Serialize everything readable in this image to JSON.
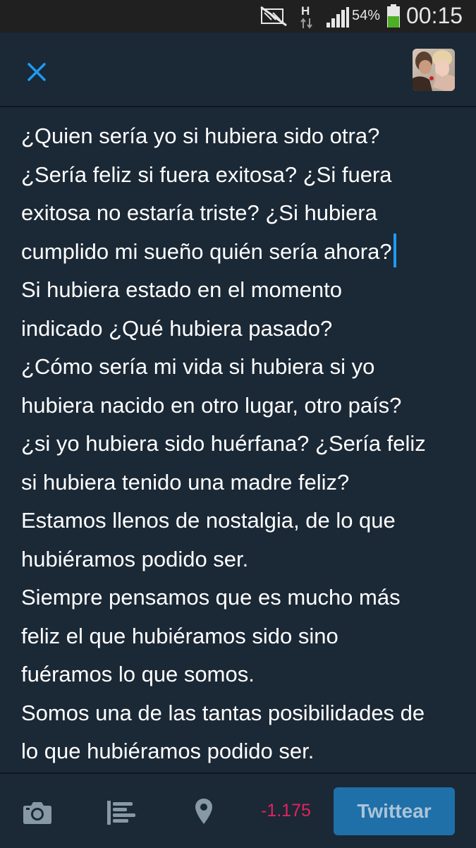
{
  "status_bar": {
    "network_label": "H",
    "battery_percent": "54%",
    "battery_level": 0.54,
    "time": "00:15",
    "icons": [
      "mute-icon",
      "data-transfer-icon",
      "signal-icon",
      "battery-icon"
    ]
  },
  "header": {
    "close_icon": "close-icon",
    "avatar": "user-avatar"
  },
  "compose": {
    "lines": [
      "¿Quien sería yo si hubiera sido otra?",
      "¿Sería feliz si fuera exitosa? ¿Si fuera",
      "exitosa no estaría triste? ¿Si hubiera",
      "cumplido mi sueño quién sería ahora?",
      "Si hubiera estado en el momento",
      "indicado ¿Qué hubiera pasado?",
      "¿Cómo sería mi vida si hubiera si yo",
      "hubiera nacido en otro lugar, otro país?",
      "¿si yo hubiera sido huérfana? ¿Sería feliz",
      "si hubiera tenido una madre feliz?",
      "Estamos llenos de nostalgia, de lo que",
      "hubiéramos podido ser.",
      "Siempre pensamos que es mucho más",
      "feliz el que hubiéramos sido sino",
      "fuéramos lo que somos.",
      "Somos una de las tantas posibilidades de",
      "lo que hubiéramos podido ser."
    ],
    "cursor_line_index": 3
  },
  "toolbar": {
    "icons": [
      "camera-icon",
      "poll-icon",
      "location-icon"
    ],
    "char_count": "-1.175",
    "tweet_button_label": "Twittear"
  },
  "colors": {
    "background": "#1b2836",
    "status_bar": "#202020",
    "accent": "#1d9bf0",
    "counter": "#e0245e",
    "button": "#1f6fa8"
  }
}
